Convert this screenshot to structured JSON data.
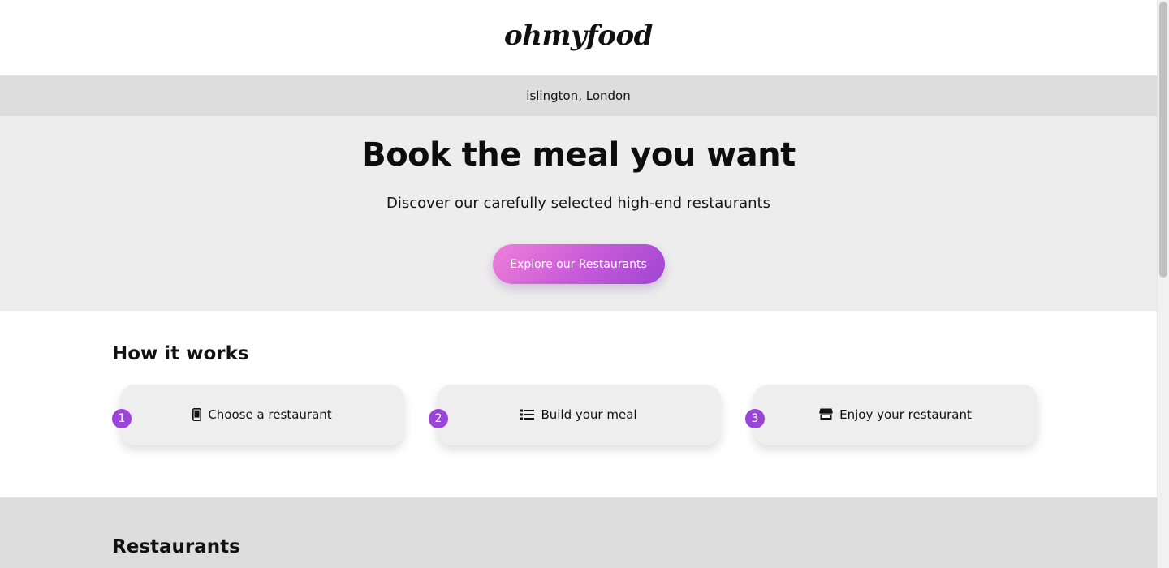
{
  "header": {
    "logo": "ohmyfood"
  },
  "location": {
    "text": "islington, London"
  },
  "hero": {
    "title": "Book the meal you want",
    "subtitle": "Discover our carefully selected high-end restaurants",
    "cta_label": "Explore our Restaurants"
  },
  "how_it_works": {
    "title": "How it works",
    "steps": [
      {
        "number": "1",
        "label": "Choose a restaurant",
        "icon": "mobile-phone-icon"
      },
      {
        "number": "2",
        "label": "Build your meal",
        "icon": "list-icon"
      },
      {
        "number": "3",
        "label": "Enjoy your restaurant",
        "icon": "store-icon"
      }
    ]
  },
  "restaurants": {
    "title": "Restaurants"
  },
  "colors": {
    "accent": "#9b45d8",
    "cta_gradient_start": "#f07fd9",
    "cta_gradient_end": "#9e45d3",
    "location_bar_bg": "#dddddd",
    "hero_bg": "#ededed"
  }
}
